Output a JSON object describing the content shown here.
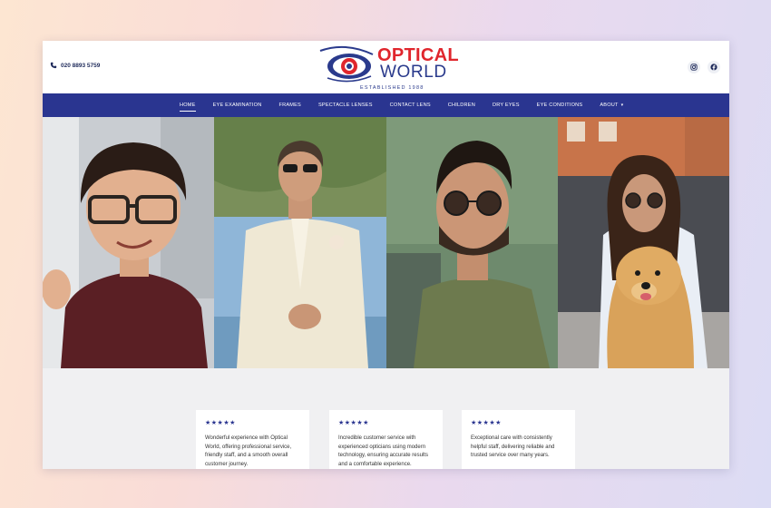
{
  "header": {
    "phone": "020 8893 5759",
    "phone_icon": "phone-icon",
    "logo_line1": "OPTICAL",
    "logo_line2": "WORLD",
    "logo_tagline": "ESTABLISHED 1988",
    "social_icons": [
      "instagram-icon",
      "facebook-icon"
    ]
  },
  "nav": {
    "items": [
      {
        "label": "HOME",
        "active": true
      },
      {
        "label": "EYE EXAMINATION"
      },
      {
        "label": "FRAMES"
      },
      {
        "label": "SPECTACLE LENSES"
      },
      {
        "label": "CONTACT LENS"
      },
      {
        "label": "CHILDREN"
      },
      {
        "label": "DRY EYES"
      },
      {
        "label": "EYE CONDITIONS"
      },
      {
        "label": "ABOUT",
        "has_dropdown": true
      }
    ]
  },
  "reviews": [
    {
      "stars": "★★★★★",
      "text": "Wonderful experience with Optical World, offering professional service, friendly staff, and a smooth overall customer journey."
    },
    {
      "stars": "★★★★★",
      "text": "Incredible customer service with experienced opticians using modern technology, ensuring accurate results and a comfortable experience."
    },
    {
      "stars": "★★★★★",
      "text": "Exceptional care with consistently helpful staff, delivering reliable and trusted service over many years."
    }
  ],
  "colors": {
    "brand_blue": "#2a3590",
    "brand_red": "#e0262d"
  }
}
